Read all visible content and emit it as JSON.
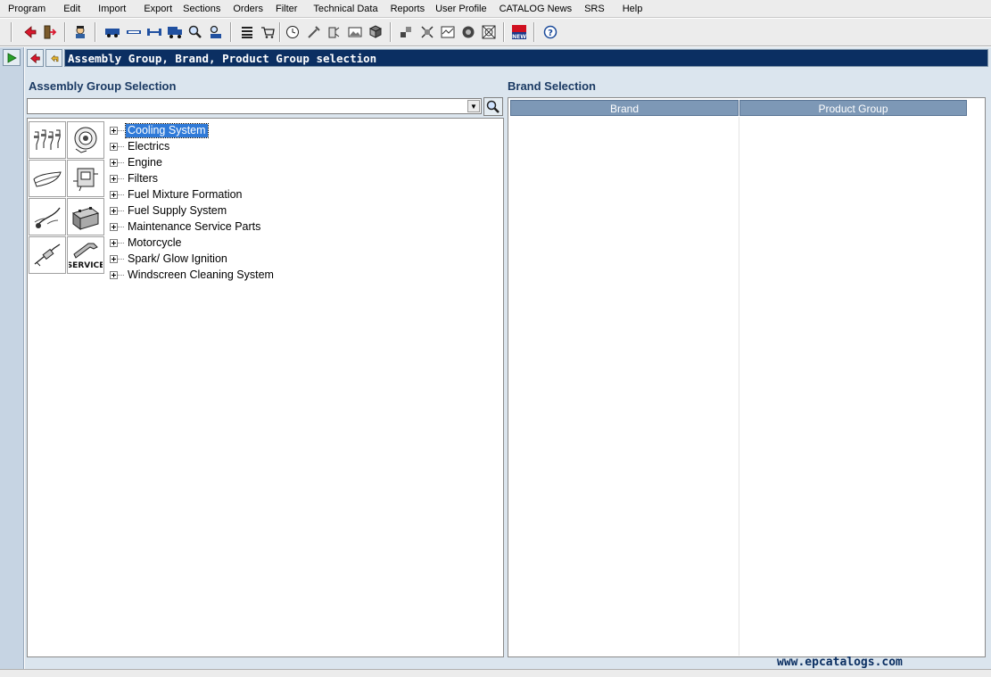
{
  "menu": [
    "Program",
    "Edit",
    "Import",
    "Export",
    "Sections",
    "Orders",
    "Filter",
    "Technical Data",
    "Reports",
    "User Profile",
    "CATALOG News",
    "SRS",
    "Help"
  ],
  "toolbar_icons": [
    "back-icon",
    "exit-icon",
    "user-icon",
    "vehicle-icon",
    "axle-icon",
    "shaft-icon",
    "truck-icon",
    "search-magnifier-icon",
    "print-icon",
    "list-icon",
    "cart-icon",
    "clock-icon",
    "tools-icon",
    "service-icon",
    "image-icon",
    "book-icon",
    "parts-icon",
    "diagram-icon",
    "chart-icon",
    "globe-icon",
    "crosshair-icon",
    "news-icon",
    "help-icon"
  ],
  "page": {
    "title": "Assembly Group, Brand, Product Group selection"
  },
  "assembly": {
    "heading": "Assembly Group Selection",
    "tree": [
      "Cooling System",
      "Electrics",
      "Engine",
      "Filters",
      "Fuel Mixture Formation",
      "Fuel Supply System",
      "Maintenance Service Parts",
      "Motorcycle",
      "Spark/ Glow Ignition",
      "Windscreen Cleaning System"
    ],
    "selected_index": 0,
    "icons": [
      "spark-plugs-icon",
      "brake-disc-icon",
      "wiper-blade-icon",
      "engine-block-icon",
      "thermometer-icon",
      "battery-icon",
      "glow-plug-icon",
      "service-wrench-icon"
    ],
    "service_label": "SERVICE"
  },
  "brand": {
    "heading": "Brand Selection",
    "columns": [
      "Brand",
      "Product Group"
    ]
  },
  "watermark": "www.epcatalogs.com",
  "colors": {
    "title_bg": "#0b2f62",
    "panel_bg": "#dbe5ee",
    "header_bg": "#7d98b6",
    "selected": "#2f7ad8"
  }
}
